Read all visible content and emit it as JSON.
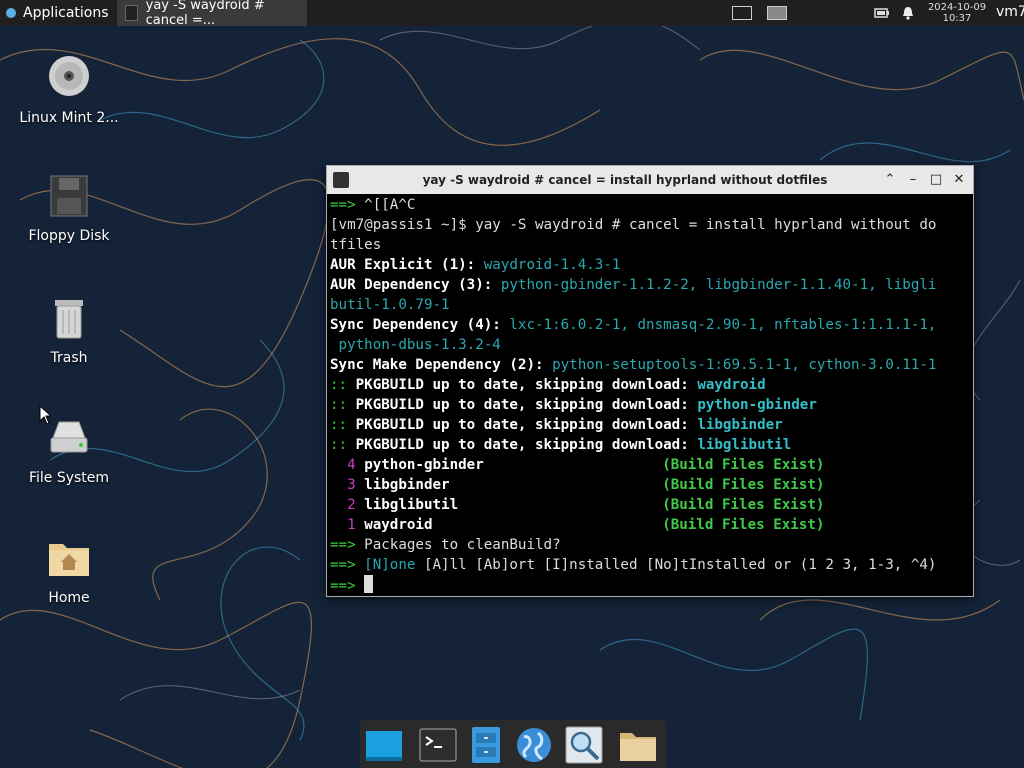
{
  "panel": {
    "applications_label": "Applications",
    "task_title": "yay -S waydroid # cancel =...",
    "clock_date": "2024-10-09",
    "clock_time": "10:37",
    "user": "vm7"
  },
  "desktop_icons": [
    {
      "label": "Linux Mint 2..."
    },
    {
      "label": "Floppy Disk"
    },
    {
      "label": "Trash"
    },
    {
      "label": "File System"
    },
    {
      "label": "Home"
    }
  ],
  "terminal": {
    "title": "yay -S waydroid # cancel = install hyprland without dotfiles",
    "arrow": "==>",
    "l1_text": " ^[[A^C",
    "l2": "[vm7@passis1 ~]$ yay -S waydroid # cancel = install hyprland without do",
    "l3": "tfiles",
    "l4_label": "AUR Explicit (1): ",
    "l4_value": "waydroid-1.4.3-1",
    "l5_label": "AUR Dependency (3): ",
    "l5_value": "python-gbinder-1.1.2-2, libgbinder-1.1.40-1, libgli",
    "l6_value": "butil-1.0.79-1",
    "l7_label": "Sync Dependency (4): ",
    "l7_value": "lxc-1:6.0.2-1, dnsmasq-2.90-1, nftables-1:1.1.1-1,",
    "l8_value": " python-dbus-1.3.2-4",
    "l9_label": "Sync Make Dependency (2): ",
    "l9_value": "python-setuptools-1:69.5.1-1, cython-3.0.11-1",
    "colons": "::",
    "pkg_msg": " PKGBUILD up to date, skipping download: ",
    "pkgs": [
      "waydroid",
      "python-gbinder",
      "libgbinder",
      "libglibutil"
    ],
    "build_list": [
      {
        "num": "4",
        "name": "python-gbinder"
      },
      {
        "num": "3",
        "name": "libgbinder"
      },
      {
        "num": "2",
        "name": "libglibutil"
      },
      {
        "num": "1",
        "name": "waydroid"
      }
    ],
    "build_status": "(Build Files Exist)",
    "clean_prompt": " Packages to cleanBuild?",
    "opt_none": "[N]one",
    "opt_rest": " [A]ll [Ab]ort [I]nstalled [No]tInstalled or (1 2 3, 1-3, ^4)"
  },
  "colors": {
    "green": "#3cd23c",
    "cyan": "#2aa8b0",
    "magenta": "#c040c0",
    "panel": "#1f1f1f"
  }
}
